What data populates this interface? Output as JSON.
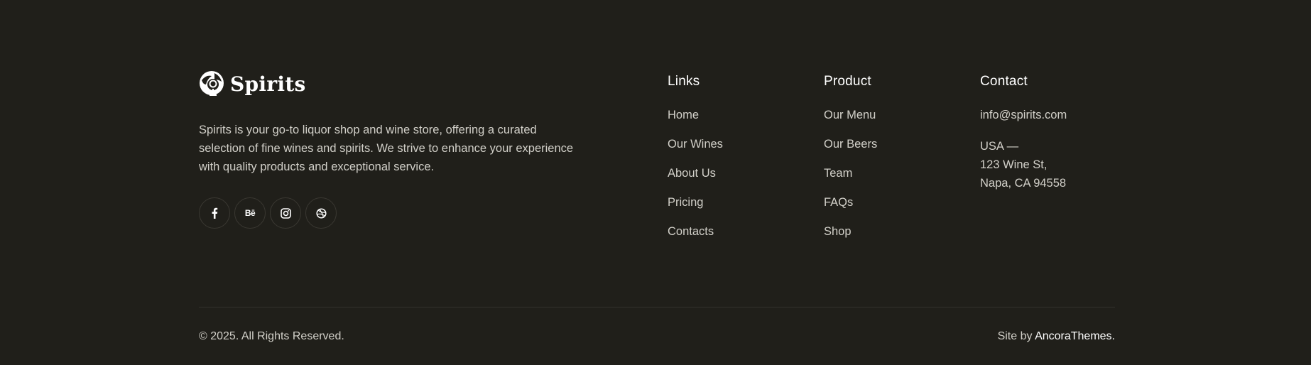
{
  "brand": {
    "name": "Spirits",
    "logo_icon": "wine-glass-logo-icon",
    "description": "Spirits is your go-to liquor shop and wine store, offering a curated selection of fine wines and spirits. We strive to enhance your experience with quality products and exceptional service."
  },
  "socials": [
    {
      "name": "facebook",
      "icon": "facebook-icon"
    },
    {
      "name": "behance",
      "icon": "behance-icon",
      "glyph": "Bē"
    },
    {
      "name": "instagram",
      "icon": "instagram-icon"
    },
    {
      "name": "dribbble",
      "icon": "dribbble-icon"
    }
  ],
  "links": {
    "heading": "Links",
    "items": [
      "Home",
      "Our Wines",
      "About Us",
      "Pricing",
      "Contacts"
    ]
  },
  "product": {
    "heading": "Product",
    "items": [
      "Our Menu",
      "Our Beers",
      "Team",
      "FAQs",
      "Shop"
    ]
  },
  "contact": {
    "heading": "Contact",
    "email": "info@spirits.com",
    "address": [
      "USA —",
      "123 Wine St,",
      "Napa, CA 94558"
    ]
  },
  "bottom": {
    "copyright": "© 2025. All Rights Reserved.",
    "credit_prefix": "Site by ",
    "credit_link": "AncoraThemes."
  },
  "colors": {
    "background": "#201f1a",
    "text": "#d2d0c9",
    "heading": "#ffffff"
  }
}
